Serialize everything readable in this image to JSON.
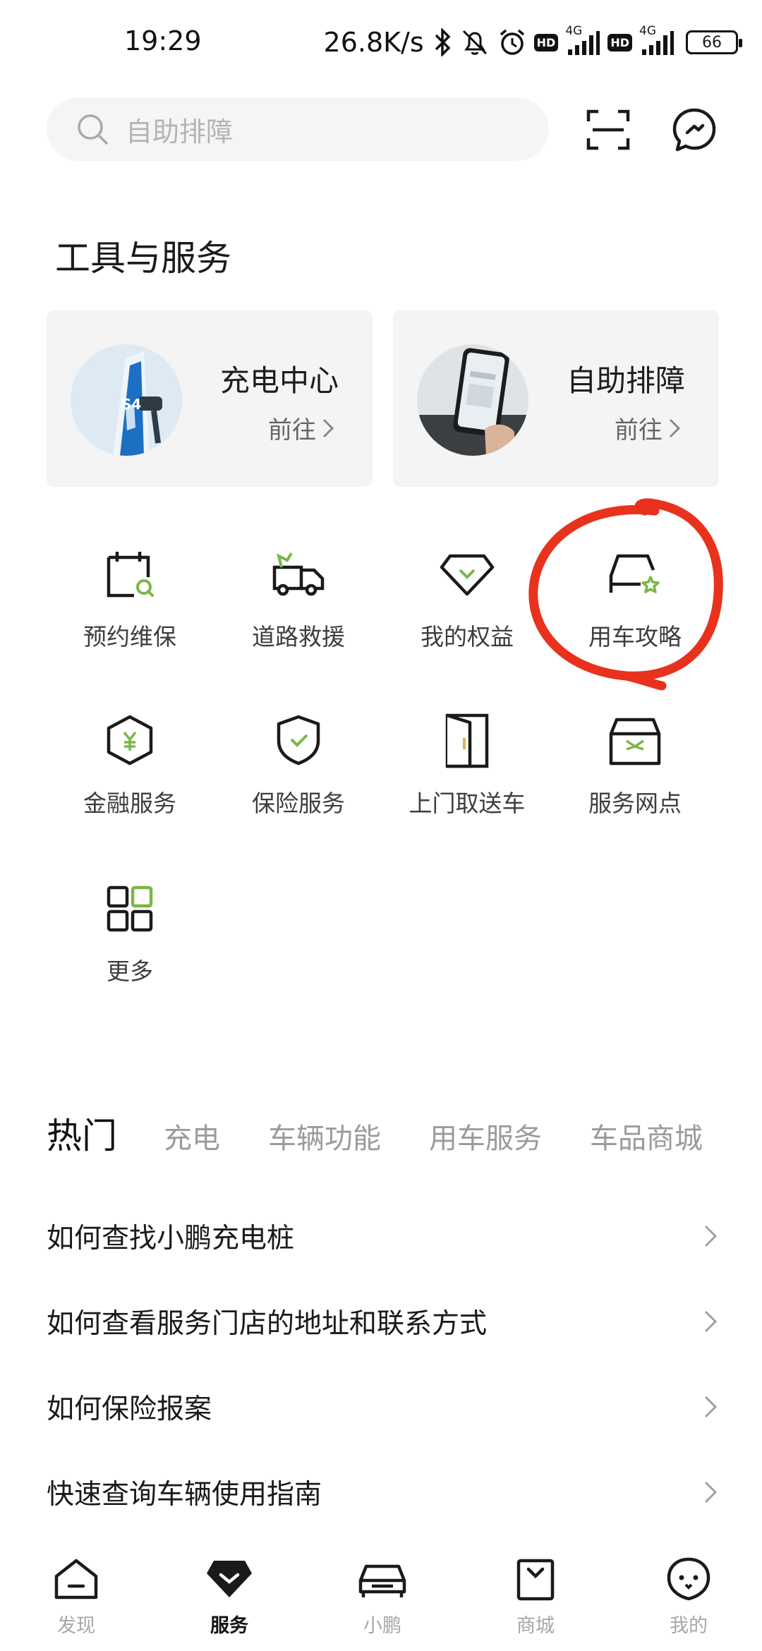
{
  "status_bar": {
    "time": "19:29",
    "net_speed": "26.8K/s",
    "network_1": "4G",
    "network_2": "4G",
    "hd": "HD",
    "battery": "66"
  },
  "search": {
    "placeholder": "自助排障"
  },
  "section_title": "工具与服务",
  "cards": [
    {
      "title": "充电中心",
      "go": "前往"
    },
    {
      "title": "自助排障",
      "go": "前往"
    }
  ],
  "services": [
    {
      "label": "预约维保",
      "icon": "calendar-search-icon"
    },
    {
      "label": "道路救援",
      "icon": "tow-truck-icon"
    },
    {
      "label": "我的权益",
      "icon": "diamond-icon"
    },
    {
      "label": "用车攻略",
      "icon": "car-star-icon"
    },
    {
      "label": "金融服务",
      "icon": "yuan-hexagon-icon"
    },
    {
      "label": "保险服务",
      "icon": "shield-check-icon"
    },
    {
      "label": "上门取送车",
      "icon": "door-icon"
    },
    {
      "label": "服务网点",
      "icon": "store-icon"
    },
    {
      "label": "更多",
      "icon": "grid-icon"
    }
  ],
  "tabs": [
    "热门",
    "充电",
    "车辆功能",
    "用车服务",
    "车品商城"
  ],
  "faq": [
    "如何查找小鹏充电桩",
    "如何查看服务门店的地址和联系方式",
    "如何保险报案",
    "快速查询车辆使用指南"
  ],
  "bottom_nav": [
    "发现",
    "服务",
    "小鹏",
    "商城",
    "我的"
  ],
  "colors": {
    "accent_green": "#7ab648",
    "annotation_red": "#e8321e"
  }
}
